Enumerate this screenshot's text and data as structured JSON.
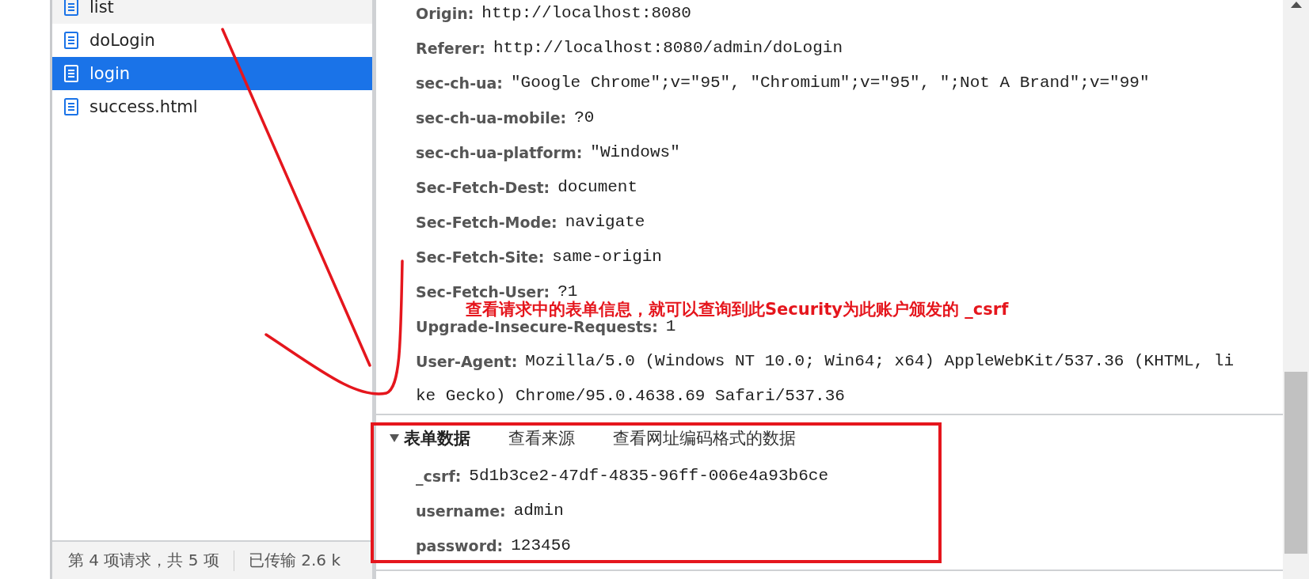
{
  "sidebar": {
    "items": [
      {
        "name": "list",
        "selected": false,
        "hovered": true
      },
      {
        "name": "doLogin",
        "selected": false,
        "hovered": false
      },
      {
        "name": "login",
        "selected": true,
        "hovered": false
      },
      {
        "name": "success.html",
        "selected": false,
        "hovered": false
      }
    ]
  },
  "status_bar": {
    "request_count": "第 4 项请求，共 5 项",
    "transferred": "已传输 2.6 k"
  },
  "headers": [
    {
      "name": "Origin:",
      "value": "http://localhost:8080"
    },
    {
      "name": "Referer:",
      "value": "http://localhost:8080/admin/doLogin"
    },
    {
      "name": "sec-ch-ua:",
      "value": "\"Google Chrome\";v=\"95\", \"Chromium\";v=\"95\", \";Not A Brand\";v=\"99\""
    },
    {
      "name": "sec-ch-ua-mobile:",
      "value": "?0"
    },
    {
      "name": "sec-ch-ua-platform:",
      "value": "\"Windows\""
    },
    {
      "name": "Sec-Fetch-Dest:",
      "value": "document"
    },
    {
      "name": "Sec-Fetch-Mode:",
      "value": "navigate"
    },
    {
      "name": "Sec-Fetch-Site:",
      "value": "same-origin"
    },
    {
      "name": "Sec-Fetch-User:",
      "value": "?1"
    },
    {
      "name": "Upgrade-Insecure-Requests:",
      "value": "1"
    },
    {
      "name": "User-Agent:",
      "value": "Mozilla/5.0 (Windows NT 10.0; Win64; x64) AppleWebKit/537.36 (KHTML, like Gecko) Chrome/95.0.4638.69 Safari/537.36"
    }
  ],
  "form_data": {
    "title": "表单数据",
    "expanded": true,
    "links": [
      "查看来源",
      "查看网址编码格式的数据"
    ],
    "fields": [
      {
        "name": "_csrf:",
        "value": "5d1b3ce2-47df-4835-96ff-006e4a93b6ce"
      },
      {
        "name": "username:",
        "value": "admin"
      },
      {
        "name": "password:",
        "value": "123456"
      }
    ]
  },
  "annotation": {
    "text": "查看请求中的表单信息，就可以查询到此Security为此账户颁发的 _csrf"
  }
}
